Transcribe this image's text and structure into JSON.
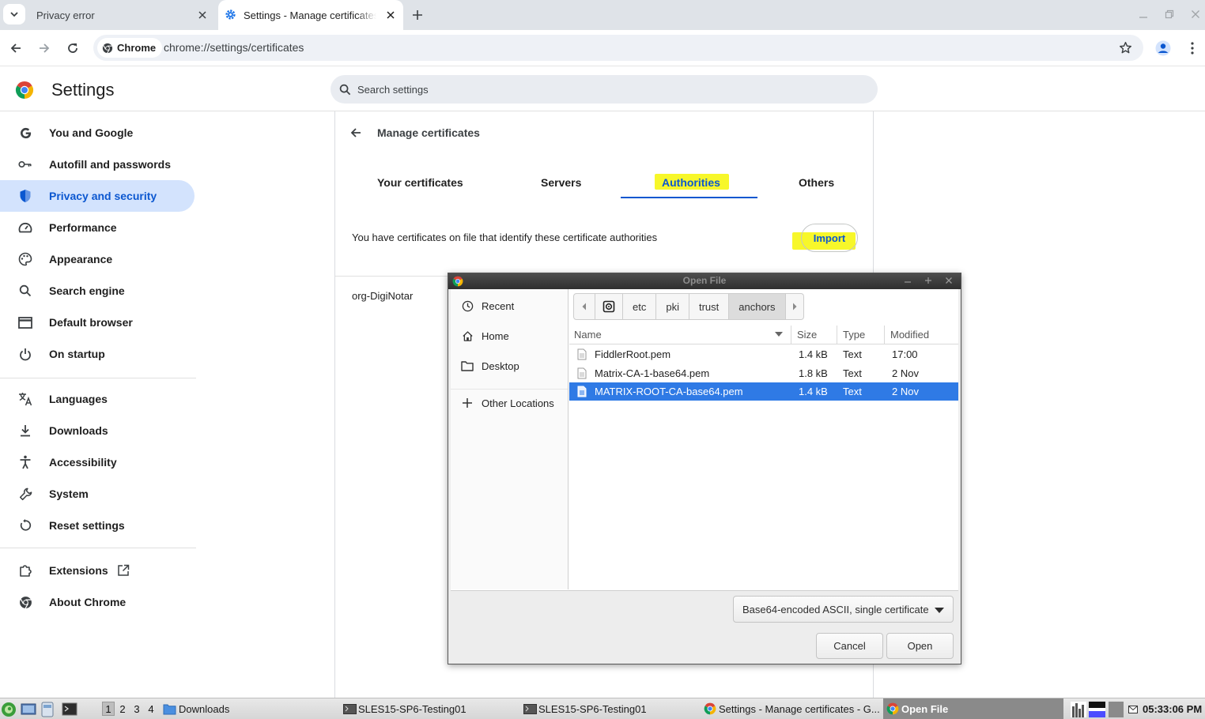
{
  "browser": {
    "tabs": [
      {
        "title": "Privacy error"
      },
      {
        "title": "Settings - Manage certificates"
      }
    ],
    "chip_label": "Chrome",
    "url": "chrome://settings/certificates"
  },
  "settings": {
    "title": "Settings",
    "search_placeholder": "Search settings",
    "nav_group1": [
      {
        "label": "You and Google",
        "icon": "google-icon"
      },
      {
        "label": "Autofill and passwords",
        "icon": "key-icon"
      },
      {
        "label": "Privacy and security",
        "icon": "shield-icon",
        "active": true
      },
      {
        "label": "Performance",
        "icon": "speedometer-icon"
      },
      {
        "label": "Appearance",
        "icon": "palette-icon"
      },
      {
        "label": "Search engine",
        "icon": "search-icon"
      },
      {
        "label": "Default browser",
        "icon": "browser-window-icon"
      },
      {
        "label": "On startup",
        "icon": "power-icon"
      }
    ],
    "nav_group2": [
      {
        "label": "Languages",
        "icon": "translate-icon"
      },
      {
        "label": "Downloads",
        "icon": "download-icon"
      },
      {
        "label": "Accessibility",
        "icon": "accessibility-icon"
      },
      {
        "label": "System",
        "icon": "wrench-icon"
      },
      {
        "label": "Reset settings",
        "icon": "reset-icon"
      }
    ],
    "nav_group3": [
      {
        "label": "Extensions",
        "icon": "extension-icon"
      },
      {
        "label": "About Chrome",
        "icon": "chrome-icon"
      }
    ]
  },
  "certificates": {
    "page_title": "Manage certificates",
    "tabs": [
      "Your certificates",
      "Servers",
      "Authorities",
      "Others"
    ],
    "active_tab": "Authorities",
    "description": "You have certificates on file that identify these certificate authorities",
    "import_label": "Import",
    "organizations": [
      "org-DigiNotar"
    ],
    "highlight_color": "#f7f72a"
  },
  "dialog": {
    "title": "Open File",
    "places": [
      {
        "label": "Recent",
        "icon": "clock-icon"
      },
      {
        "label": "Home",
        "icon": "home-icon"
      },
      {
        "label": "Desktop",
        "icon": "folder-icon"
      },
      {
        "label": "Other Locations",
        "icon": "plus-icon"
      }
    ],
    "path": [
      "etc",
      "pki",
      "trust",
      "anchors"
    ],
    "columns": [
      "Name",
      "Size",
      "Type",
      "Modified"
    ],
    "files": [
      {
        "name": "FiddlerRoot.pem",
        "size": "1.4 kB",
        "type": "Text",
        "modified": "17:00"
      },
      {
        "name": "Matrix-CA-1-base64.pem",
        "size": "1.8 kB",
        "type": "Text",
        "modified": "2 Nov"
      },
      {
        "name": "MATRIX-ROOT-CA-base64.pem",
        "size": "1.4 kB",
        "type": "Text",
        "modified": "2 Nov",
        "selected": true
      }
    ],
    "filter": "Base64-encoded ASCII, single certificate",
    "cancel_label": "Cancel",
    "open_label": "Open",
    "selection_color": "#2f7ae5"
  },
  "taskbar": {
    "workspaces": [
      "1",
      "2",
      "3",
      "4"
    ],
    "current_workspace": "1",
    "items": [
      {
        "label": "Downloads",
        "icon": "folder-icon"
      },
      {
        "label": "SLES15-SP6-Testing01",
        "icon": "terminal-icon"
      },
      {
        "label": "SLES15-SP6-Testing01",
        "icon": "terminal-icon"
      },
      {
        "label": "Settings - Manage certificates - G...",
        "icon": "chrome-icon"
      },
      {
        "label": "Open File",
        "icon": "chrome-icon"
      }
    ],
    "clock": "05:33:06 PM"
  }
}
